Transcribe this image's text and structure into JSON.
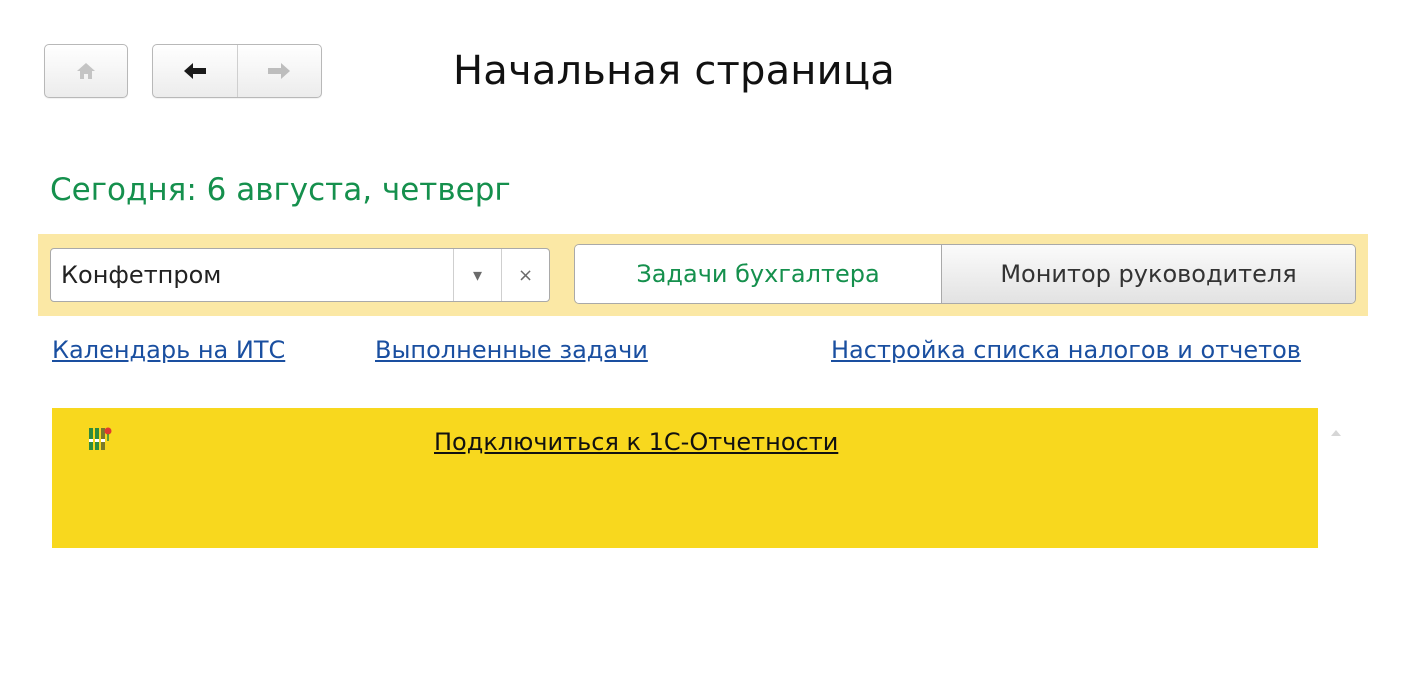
{
  "header": {
    "title": "Начальная страница",
    "home_icon": "home-icon",
    "back_icon": "arrow-left-icon",
    "forward_icon": "arrow-right-icon"
  },
  "today": "Сегодня: 6 августа, четверг",
  "toolbar": {
    "organization": {
      "value": "Конфетпром",
      "dropdown_symbol": "▾",
      "clear_symbol": "×"
    },
    "tabs": [
      {
        "label": "Задачи бухгалтера",
        "active": true
      },
      {
        "label": "Монитор руководителя",
        "active": false
      }
    ]
  },
  "links": {
    "calendar": "Календарь на ИТС",
    "completed_tasks": "Выполненные задачи",
    "taxes_settings": "Настройка списка налогов и отчетов"
  },
  "notice": {
    "icon": "reporting-icon",
    "link": "Подключиться к 1С-Отчетности"
  },
  "colors": {
    "accent_green": "#15904d",
    "link_blue": "#1a4fa0",
    "toolbar_band": "#fbe8a5",
    "notice_yellow": "#f8d81e"
  }
}
